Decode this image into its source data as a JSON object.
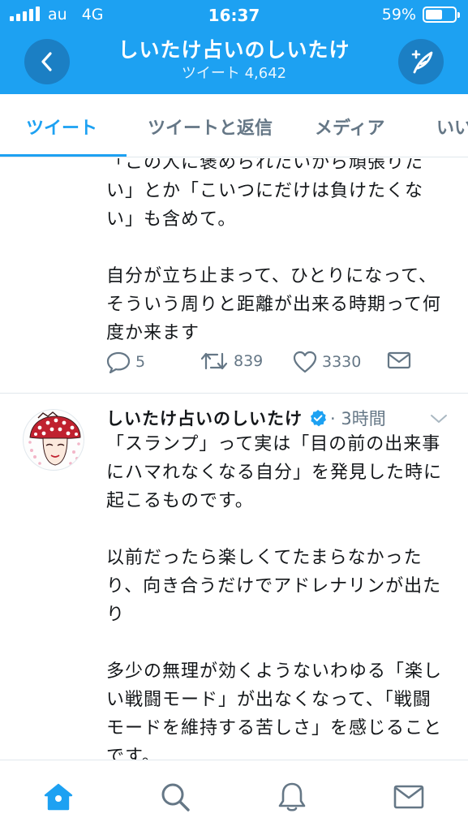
{
  "status": {
    "carrier": "au",
    "network": "4G",
    "time": "16:37",
    "battery": "59%",
    "battery_level": 0.59
  },
  "header": {
    "title": "しいたけ占いのしいたけ",
    "subtitle": "ツイート 4,642"
  },
  "tabs": [
    {
      "label": "ツイート",
      "active": true
    },
    {
      "label": "ツイートと返信",
      "active": false
    },
    {
      "label": "メディア",
      "active": false
    },
    {
      "label": "いいね",
      "active": false
    }
  ],
  "tweets": [
    {
      "text": "「この人に褒められたいから頑張りたい」とか「こいつにだけは負けたくない」も含めて。\n\n自分が立ち止まって、ひとりになって、そういう周りと距離が出来る時期って何度か来ます",
      "replies": "5",
      "retweets": "839",
      "likes": "3330"
    },
    {
      "author": "しいたけ占いのしいたけ",
      "meta": "· 3時間",
      "text": "「スランプ」って実は「目の前の出来事にハマれなくなる自分」を発見した時に起こるものです。\n\n以前だったら楽しくてたまらなかったり、向き合うだけでアドレナリンが出たり\n\n多少の無理が効くようないわゆる「楽しい戦闘モード」が出なくなって、「戦闘モードを維持する苦しさ」を感じることです。"
    }
  ],
  "colors": {
    "brand": "#1da1f2",
    "header_button": "#1b7fc4",
    "muted": "#657786",
    "text": "#14171a"
  },
  "icons": {
    "header": [
      "back-icon",
      "compose-icon"
    ],
    "actions": [
      "reply-icon",
      "retweet-icon",
      "like-icon",
      "dm-icon"
    ],
    "nav": [
      "home-icon",
      "search-icon",
      "notifications-icon",
      "messages-icon"
    ]
  }
}
